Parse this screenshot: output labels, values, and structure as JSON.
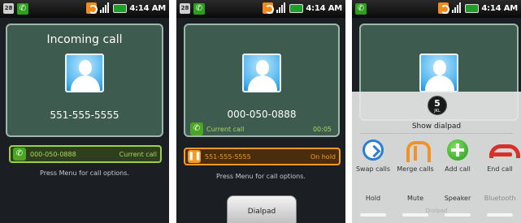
{
  "status_bar": {
    "time": "4:14 AM",
    "calendar_icon_text": "28",
    "icons": [
      "calendar-icon",
      "phone-call-icon",
      "sync-icon",
      "signal-icon",
      "battery-icon"
    ]
  },
  "screen1": {
    "title": "Incoming call",
    "number": "551-555-5555",
    "call_bar": {
      "number": "000-050-0888",
      "status": "Current call",
      "icon": "phone-icon"
    },
    "hint": "Press Menu for call options."
  },
  "screen2": {
    "number": "000-050-0888",
    "current": {
      "label": "Current call",
      "time": "00:05",
      "icon": "phone-icon"
    },
    "hold_bar": {
      "number": "551-555-5555",
      "status": "On hold",
      "icon": "pause-icon"
    },
    "hint": "Press Menu for call options.",
    "dialpad_label": "Dialpad"
  },
  "screen3": {
    "keypad": {
      "digit": "5",
      "letters": "JKL"
    },
    "show_dialpad": "Show dialpad",
    "menu_items": [
      {
        "label": "Swap calls",
        "icon": "swap-icon"
      },
      {
        "label": "Merge calls",
        "icon": "merge-icon"
      },
      {
        "label": "Add call",
        "icon": "add-call-icon"
      },
      {
        "label": "End call",
        "icon": "end-call-icon"
      }
    ],
    "toggles": [
      {
        "label": "Hold"
      },
      {
        "label": "Mute"
      },
      {
        "label": "Speaker"
      },
      {
        "label": "Bluetooth"
      }
    ],
    "dialpad_label": "Dialpad"
  },
  "colors": {
    "card_bg": "#3d5b4e",
    "current_green": "#9ad14a",
    "hold_orange": "#f49b27",
    "end_red": "#d9312a",
    "add_green": "#239a1c"
  }
}
